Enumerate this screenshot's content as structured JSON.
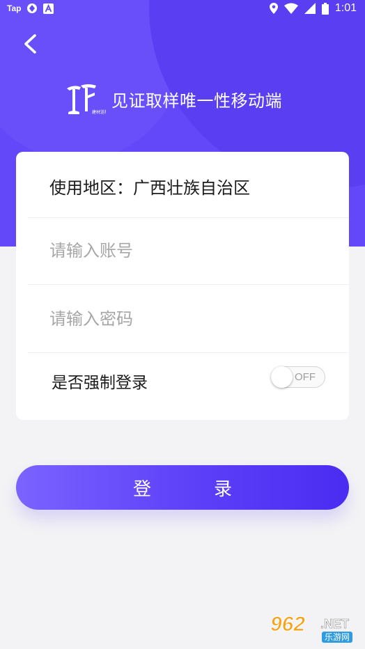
{
  "status_bar": {
    "left_label": "Tap",
    "time": "1:01"
  },
  "header": {
    "title": "见证取样唯一性移动端",
    "logo_small_text": "建材送检"
  },
  "form": {
    "region_label": "使用地区：广西壮族自治区",
    "account_placeholder": "请输入账号",
    "password_placeholder": "请输入密码",
    "force_login_label": "是否强制登录",
    "force_login_state": "OFF"
  },
  "login_button": {
    "label": "登录"
  },
  "watermark": {
    "number": "962",
    "suffix": ".NET",
    "sub": "乐游网"
  },
  "colors": {
    "primary": "#6248f8",
    "primary_dark": "#4a2cf2",
    "background": "#f3f3f5"
  }
}
